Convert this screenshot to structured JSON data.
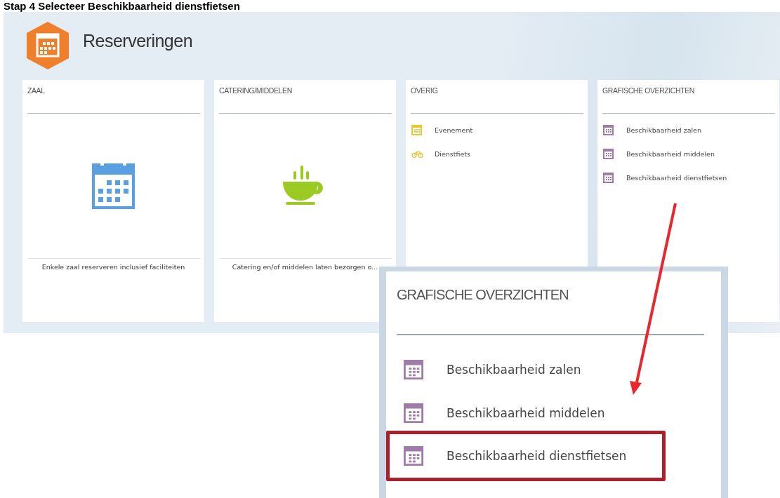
{
  "heading": "Stap 4 Selecteer Beschikbaarheid dienstfietsen",
  "app": {
    "title": "Reserveringen"
  },
  "cards": [
    {
      "title": "ZAAL",
      "kind": "tile",
      "caption": "Enkele zaal reserveren inclusief faciliteiten"
    },
    {
      "title": "CATERING/MIDDELEN",
      "kind": "tile",
      "caption": "Catering en/of middelen laten bezorgen o..."
    },
    {
      "title": "OVERIG",
      "kind": "list",
      "items": [
        {
          "label": "Evenement"
        },
        {
          "label": "Dienstfiets"
        }
      ]
    },
    {
      "title": "GRAFISCHE OVERZICHTEN",
      "kind": "list",
      "items": [
        {
          "label": "Beschikbaarheid zalen"
        },
        {
          "label": "Beschikbaarheid middelen"
        },
        {
          "label": "Beschikbaarheid dienstfietsen"
        }
      ]
    }
  ],
  "callout": {
    "title": "GRAFISCHE OVERZICHTEN",
    "items": [
      {
        "label": "Beschikbaarheid zalen",
        "selected": false
      },
      {
        "label": "Beschikbaarheid middelen",
        "selected": false
      },
      {
        "label": "Beschikbaarheid dienstfietsen",
        "selected": true
      }
    ]
  }
}
